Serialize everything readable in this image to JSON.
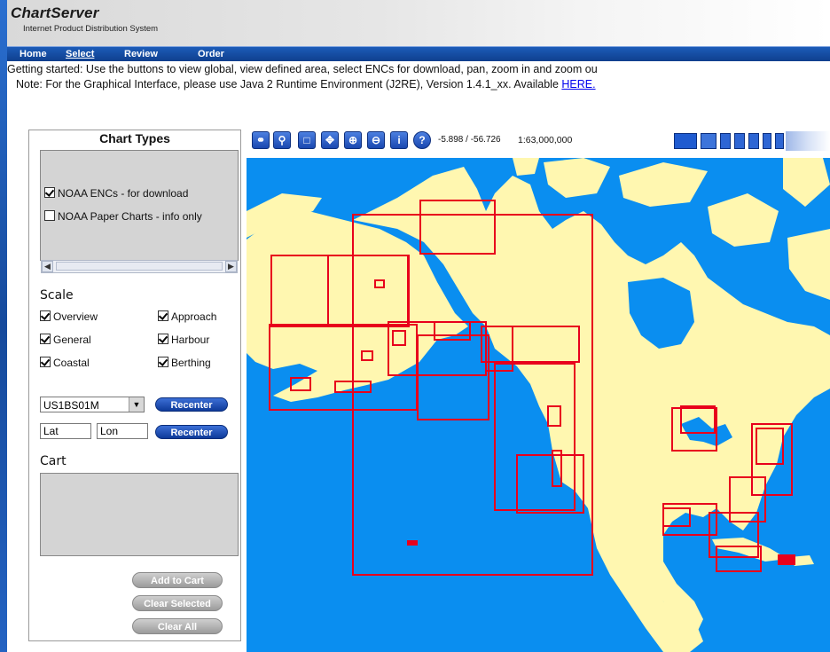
{
  "app": {
    "title": "ChartServer",
    "subtitle": "Internet Product Distribution System"
  },
  "nav": {
    "items": [
      {
        "label": "Home"
      },
      {
        "label": "Select"
      },
      {
        "label": "Review"
      },
      {
        "label": "Order"
      }
    ],
    "active": "Select"
  },
  "info": {
    "line1": "Getting started: Use the buttons to view global, view defined area, select ENCs for download, pan, zoom in and zoom ou",
    "line2_prefix": "Note: For the Graphical Interface, please use Java 2 Runtime Environment (J2RE), Version 1.4.1_xx. Available ",
    "line2_link": "HERE."
  },
  "panel": {
    "chart_types_title": "Chart Types",
    "chart_types": [
      {
        "label": "NOAA ENCs - for download",
        "checked": true
      },
      {
        "label": "NOAA Paper Charts - info only",
        "checked": false
      }
    ],
    "scale_label": "Scale",
    "scale_options": [
      {
        "label": "Overview",
        "checked": true
      },
      {
        "label": "Approach",
        "checked": true
      },
      {
        "label": "General",
        "checked": true
      },
      {
        "label": "Harbour",
        "checked": true
      },
      {
        "label": "Coastal",
        "checked": true
      },
      {
        "label": "Berthing",
        "checked": true
      }
    ],
    "chart_select_value": "US1BS01M",
    "recenter_label": "Recenter",
    "lat_placeholder": "Lat",
    "lon_placeholder": "Lon",
    "cart_label": "Cart",
    "add_to_cart": "Add to Cart",
    "clear_selected": "Clear Selected",
    "clear_all": "Clear All"
  },
  "toolbar": {
    "coords": "-5.898 / -56.726",
    "scale": "1:63,000,000",
    "buttons": [
      "globe-icon",
      "view-area-icon",
      "select-icon",
      "pan-icon",
      "zoom-in-icon",
      "zoom-out-icon",
      "info-icon",
      "help-icon"
    ]
  },
  "colors": {
    "header_blue": "#1c5cb8",
    "sea": "#0a8ef0",
    "land": "#fff7b0",
    "chart_outline": "#e8001c"
  }
}
